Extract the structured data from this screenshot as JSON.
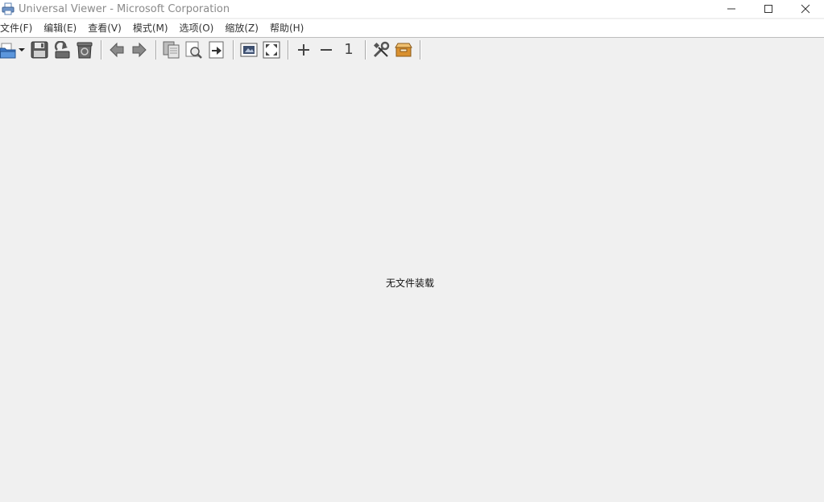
{
  "window": {
    "title": "Universal Viewer - Microsoft Corporation",
    "app_icon": "printer-icon",
    "controls": {
      "minimize": "minimize-icon",
      "maximize": "maximize-icon",
      "close": "close-icon"
    }
  },
  "menubar": {
    "items": [
      {
        "label": "文件(F)"
      },
      {
        "label": "编辑(E)"
      },
      {
        "label": "查看(V)"
      },
      {
        "label": "模式(M)"
      },
      {
        "label": "选项(O)"
      },
      {
        "label": "缩放(Z)"
      },
      {
        "label": "帮助(H)"
      }
    ]
  },
  "toolbar": {
    "buttons": [
      {
        "icon": "open-folder-icon"
      },
      {
        "icon": "save-icon"
      },
      {
        "icon": "reload-icon"
      },
      {
        "icon": "recycle-bin-icon"
      },
      {
        "icon": "arrow-left-icon"
      },
      {
        "icon": "arrow-right-icon"
      },
      {
        "icon": "copy-icon"
      },
      {
        "icon": "find-icon"
      },
      {
        "icon": "goto-icon"
      },
      {
        "icon": "fit-window-icon"
      },
      {
        "icon": "fullscreen-icon"
      },
      {
        "icon": "zoom-in-icon"
      },
      {
        "icon": "zoom-out-icon"
      },
      {
        "icon": "actual-size-icon"
      },
      {
        "icon": "settings-tools-icon"
      },
      {
        "icon": "plugins-box-icon"
      }
    ],
    "actual_size_label": "1"
  },
  "content": {
    "empty_message": "无文件装载"
  },
  "colors": {
    "window_bg": "#f0f0f0",
    "bar_bg": "#ffffff",
    "title_text": "#8a8a8a",
    "icon_blue": "#3b76c4",
    "icon_gray": "#6b6b6b",
    "icon_orange": "#d9902f"
  }
}
